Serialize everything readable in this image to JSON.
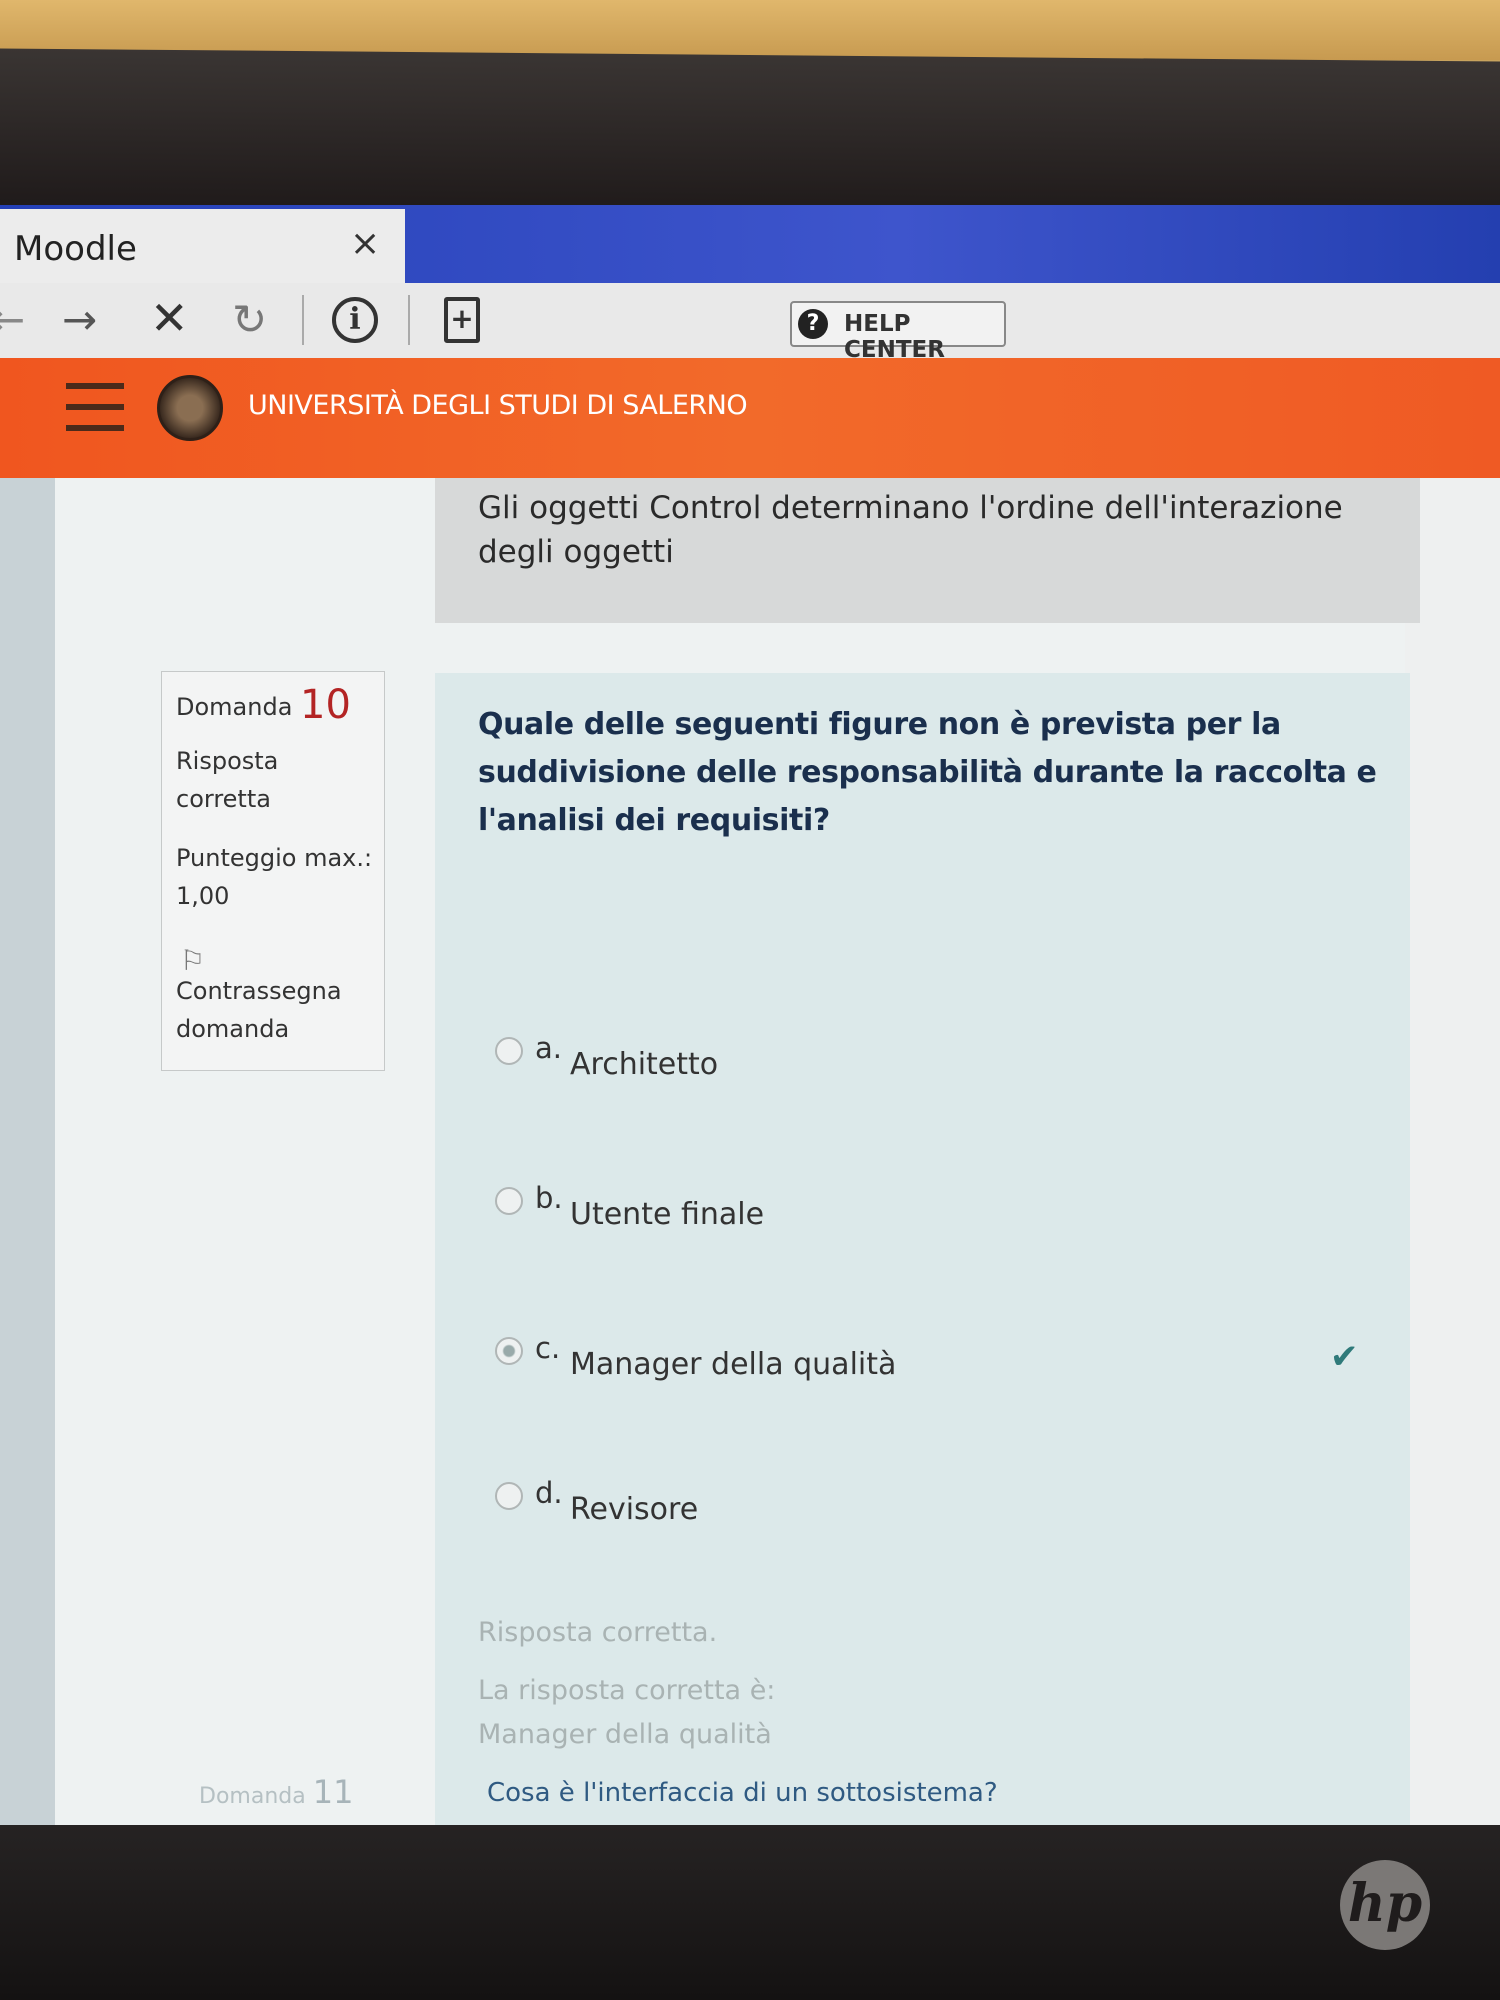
{
  "browser": {
    "tab_title": "Moodle",
    "tab_close": "×",
    "help_center_label": "HELP CENTER",
    "help_icon": "?",
    "icons": [
      "back-icon",
      "forward-icon",
      "stop-icon",
      "reload-icon",
      "info-icon",
      "new-document-icon",
      "help-icon",
      "close-icon"
    ]
  },
  "site": {
    "university_name": "UNIVERSITÀ DEGLI STUDI DI SALERNO",
    "colors": {
      "header": "#f0561f",
      "tab_bar": "#2440b7"
    }
  },
  "previous_question": {
    "answer_text": "Gli oggetti Control determinano l'ordine dell'interazione degli oggetti"
  },
  "question": {
    "label": "Domanda",
    "number": "10",
    "status": "Risposta corretta",
    "points": "Punteggio max.: 1,00",
    "flag_label": "Contrassegna domanda",
    "text": "Quale delle seguenti figure non è prevista per la suddivisione delle responsabilità durante la raccolta e l'analisi dei requisiti?",
    "options": [
      {
        "letter": "a.",
        "text": "Architetto",
        "selected": false
      },
      {
        "letter": "b.",
        "text": "Utente finale",
        "selected": false
      },
      {
        "letter": "c.",
        "text": "Manager della qualità",
        "selected": true
      },
      {
        "letter": "d.",
        "text": "Revisore",
        "selected": false
      }
    ],
    "feedback_status": "Risposta corretta.",
    "feedback_answer": "La risposta corretta è: Manager della qualità"
  },
  "next_question": {
    "label": "Domanda",
    "number": "11",
    "text": "Cosa è l'interfaccia di un sottosistema?"
  },
  "device": {
    "logo": "hp"
  }
}
